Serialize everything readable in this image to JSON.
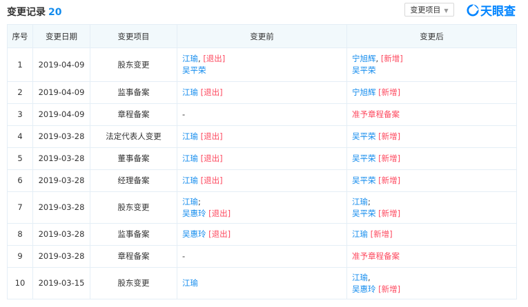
{
  "header": {
    "title": "变更记录",
    "count": "20",
    "filter_label": "变更项目",
    "logo_text": "天眼查"
  },
  "columns": [
    "序号",
    "变更日期",
    "变更项目",
    "变更前",
    "变更后"
  ],
  "rows": [
    {
      "no": "1",
      "date": "2019-04-09",
      "item": "股东变更",
      "before": [
        [
          {
            "t": "江瑜",
            "c": "link"
          },
          {
            "t": ", ",
            "c": "plain"
          },
          {
            "t": "[退出]",
            "c": "red"
          }
        ],
        [
          {
            "t": "吴平荣",
            "c": "link"
          }
        ]
      ],
      "after": [
        [
          {
            "t": "宁旭辉",
            "c": "link"
          },
          {
            "t": ", ",
            "c": "plain"
          },
          {
            "t": "[新增]",
            "c": "red"
          }
        ],
        [
          {
            "t": "吴平荣",
            "c": "link"
          }
        ]
      ]
    },
    {
      "no": "2",
      "date": "2019-04-09",
      "item": "监事备案",
      "before": [
        [
          {
            "t": "江瑜 ",
            "c": "link"
          },
          {
            "t": "[退出]",
            "c": "red"
          }
        ]
      ],
      "after": [
        [
          {
            "t": "宁旭辉 ",
            "c": "link"
          },
          {
            "t": "[新增]",
            "c": "red"
          }
        ]
      ]
    },
    {
      "no": "3",
      "date": "2019-04-09",
      "item": "章程备案",
      "before": [
        [
          {
            "t": "-",
            "c": "plain"
          }
        ]
      ],
      "after": [
        [
          {
            "t": "准予章程备案",
            "c": "red"
          }
        ]
      ]
    },
    {
      "no": "4",
      "date": "2019-03-28",
      "item": "法定代表人变更",
      "before": [
        [
          {
            "t": "江瑜 ",
            "c": "link"
          },
          {
            "t": "[退出]",
            "c": "red"
          }
        ]
      ],
      "after": [
        [
          {
            "t": "吴平荣 ",
            "c": "link"
          },
          {
            "t": "[新增]",
            "c": "red"
          }
        ]
      ]
    },
    {
      "no": "5",
      "date": "2019-03-28",
      "item": "董事备案",
      "before": [
        [
          {
            "t": "江瑜 ",
            "c": "link"
          },
          {
            "t": "[退出]",
            "c": "red"
          }
        ]
      ],
      "after": [
        [
          {
            "t": "吴平荣 ",
            "c": "link"
          },
          {
            "t": "[新增]",
            "c": "red"
          }
        ]
      ]
    },
    {
      "no": "6",
      "date": "2019-03-28",
      "item": "经理备案",
      "before": [
        [
          {
            "t": "江瑜 ",
            "c": "link"
          },
          {
            "t": "[退出]",
            "c": "red"
          }
        ]
      ],
      "after": [
        [
          {
            "t": "吴平荣 ",
            "c": "link"
          },
          {
            "t": "[新增]",
            "c": "red"
          }
        ]
      ]
    },
    {
      "no": "7",
      "date": "2019-03-28",
      "item": "股东变更",
      "before": [
        [
          {
            "t": "江瑜",
            "c": "link"
          },
          {
            "t": ";",
            "c": "plain"
          }
        ],
        [
          {
            "t": "吴惠玲 ",
            "c": "link"
          },
          {
            "t": "[退出]",
            "c": "red"
          }
        ]
      ],
      "after": [
        [
          {
            "t": "江瑜",
            "c": "link"
          },
          {
            "t": ";",
            "c": "plain"
          }
        ],
        [
          {
            "t": "吴平荣 ",
            "c": "link"
          },
          {
            "t": "[新增]",
            "c": "red"
          }
        ]
      ]
    },
    {
      "no": "8",
      "date": "2019-03-28",
      "item": "监事备案",
      "before": [
        [
          {
            "t": "吴惠玲 ",
            "c": "link"
          },
          {
            "t": "[退出]",
            "c": "red"
          }
        ]
      ],
      "after": [
        [
          {
            "t": "江瑜 ",
            "c": "link"
          },
          {
            "t": "[新增]",
            "c": "red"
          }
        ]
      ]
    },
    {
      "no": "9",
      "date": "2019-03-28",
      "item": "章程备案",
      "before": [
        [
          {
            "t": "-",
            "c": "plain"
          }
        ]
      ],
      "after": [
        [
          {
            "t": "准予章程备案",
            "c": "red"
          }
        ]
      ]
    },
    {
      "no": "10",
      "date": "2019-03-15",
      "item": "股东变更",
      "before": [
        [
          {
            "t": "江瑜",
            "c": "link"
          }
        ]
      ],
      "after": [
        [
          {
            "t": "江瑜",
            "c": "link"
          },
          {
            "t": ",",
            "c": "plain"
          }
        ],
        [
          {
            "t": "吴惠玲 ",
            "c": "link"
          },
          {
            "t": "[新增]",
            "c": "red"
          }
        ]
      ]
    }
  ]
}
